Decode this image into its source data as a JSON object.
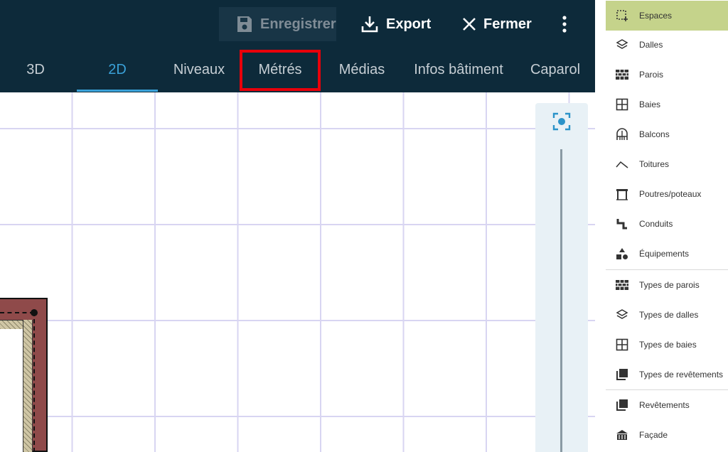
{
  "header": {
    "actions": {
      "save": "Enregistrer",
      "export": "Export",
      "close": "Fermer"
    },
    "tabs": [
      {
        "label": "3D",
        "active": false
      },
      {
        "label": "2D",
        "active": true
      },
      {
        "label": "Niveaux",
        "active": false
      },
      {
        "label": "Métrés",
        "active": false
      },
      {
        "label": "Médias",
        "active": false
      },
      {
        "label": "Infos bâtiment",
        "active": false
      },
      {
        "label": "Caparol",
        "active": false
      }
    ]
  },
  "sidebar": {
    "items": [
      {
        "label": "Espaces",
        "icon": "select-area-icon",
        "active": true
      },
      {
        "label": "Dalles",
        "icon": "layers-icon"
      },
      {
        "label": "Parois",
        "icon": "bricks-icon"
      },
      {
        "label": "Baies",
        "icon": "window-icon"
      },
      {
        "label": "Balcons",
        "icon": "balcony-icon"
      },
      {
        "label": "Toitures",
        "icon": "roof-icon"
      },
      {
        "label": "Poutres/poteaux",
        "icon": "beam-icon"
      },
      {
        "label": "Conduits",
        "icon": "duct-icon"
      },
      {
        "label": "Équipements",
        "icon": "shapes-icon"
      },
      {
        "label": "Types de parois",
        "icon": "bricks-icon"
      },
      {
        "label": "Types de dalles",
        "icon": "layers-icon"
      },
      {
        "label": "Types de baies",
        "icon": "window-icon"
      },
      {
        "label": "Types de revêtements",
        "icon": "stack-icon"
      },
      {
        "label": "Revêtements",
        "icon": "stack-icon"
      },
      {
        "label": "Façade",
        "icon": "building-icon"
      }
    ]
  },
  "colors": {
    "header_bg": "#0d2a3a",
    "tab_active": "#3aa1d8",
    "sidebar_active": "#c5d38b",
    "highlight": "#e8000a"
  }
}
